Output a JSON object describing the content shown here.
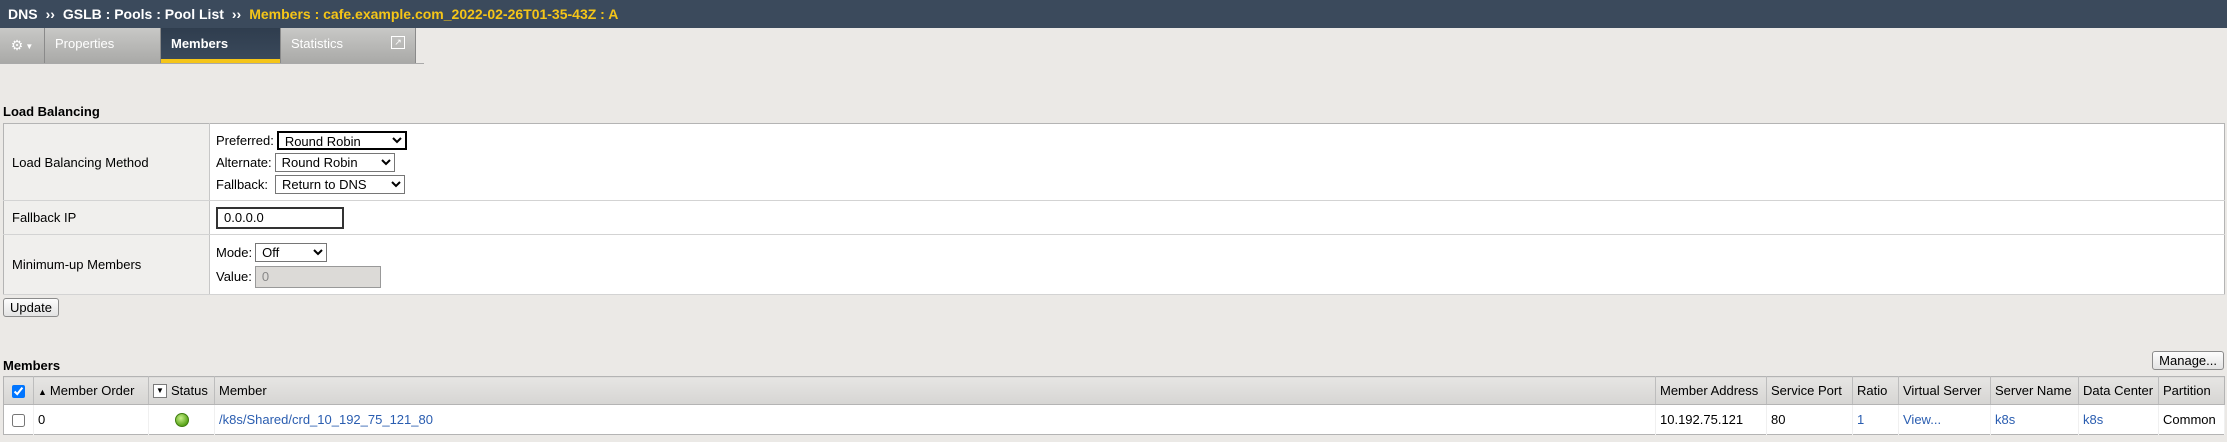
{
  "breadcrumb": {
    "items": [
      "DNS",
      "GSLB : Pools : Pool List"
    ],
    "separator": "››",
    "current": "Members : cafe.example.com_2022-02-26T01-35-43Z : A"
  },
  "tabs": {
    "gear_icon": "gear-icon",
    "properties": "Properties",
    "members": "Members",
    "statistics": "Statistics"
  },
  "load_balancing": {
    "section_title": "Load Balancing",
    "method_label": "Load Balancing Method",
    "preferred_label": "Preferred:",
    "preferred_value": "Round Robin",
    "alternate_label": "Alternate:",
    "alternate_value": "Round Robin",
    "fallback_label": "Fallback:",
    "fallback_value": "Return to DNS",
    "fallback_ip_label": "Fallback IP",
    "fallback_ip_value": "0.0.0.0",
    "min_up_label": "Minimum-up Members",
    "mode_label": "Mode:",
    "mode_value": "Off",
    "value_label": "Value:",
    "value_value": "0",
    "update_button": "Update"
  },
  "members": {
    "section_title": "Members",
    "manage_button": "Manage...",
    "columns": {
      "member_order": "Member Order",
      "status": "Status",
      "member": "Member",
      "member_address": "Member Address",
      "service_port": "Service Port",
      "ratio": "Ratio",
      "virtual_server": "Virtual Server",
      "server_name": "Server Name",
      "data_center": "Data Center",
      "partition": "Partition"
    },
    "rows": [
      {
        "order": "0",
        "status": "available",
        "member": "/k8s/Shared/crd_10_192_75_121_80",
        "address": "10.192.75.121",
        "port": "80",
        "ratio": "1",
        "virtual_server": "View...",
        "server_name": "k8s",
        "data_center": "k8s",
        "partition": "Common"
      }
    ]
  },
  "colors": {
    "titlebar": "#3b4a5c",
    "accent": "#f5c518",
    "link": "#2a5db0",
    "status_green": "#5aa51a"
  }
}
